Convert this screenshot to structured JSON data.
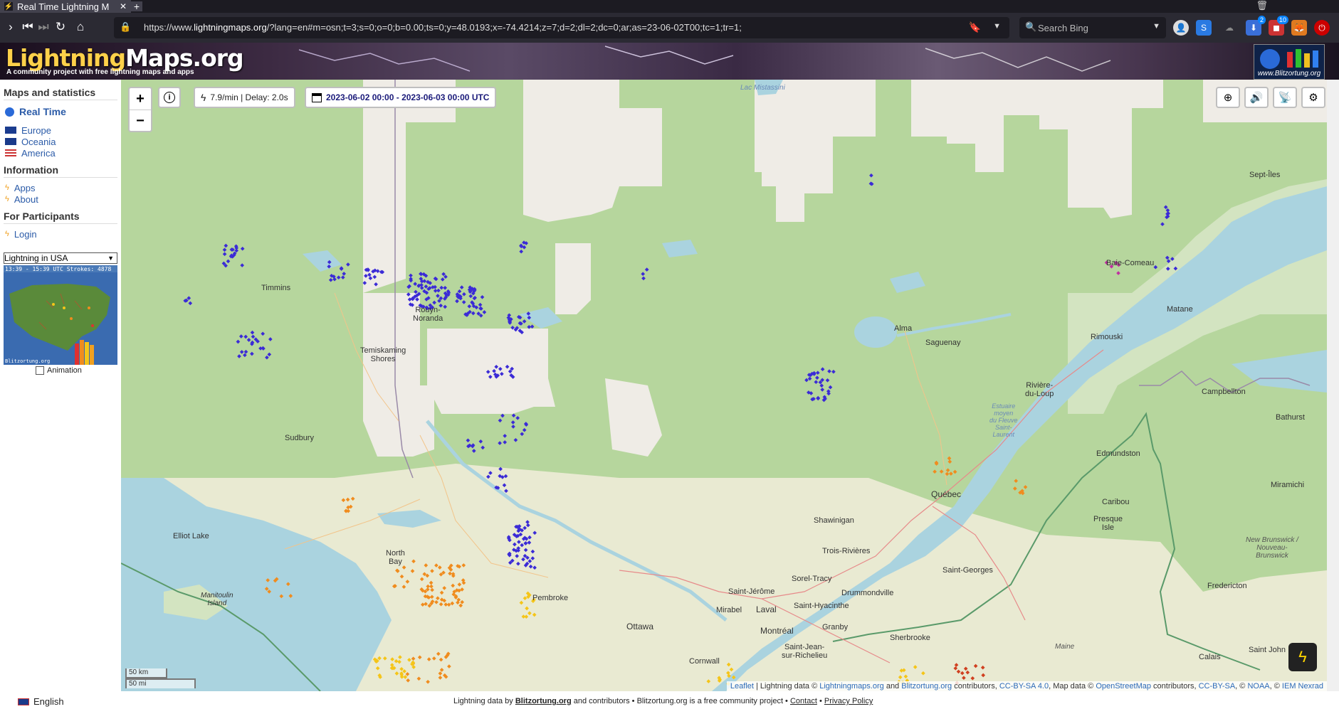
{
  "browser": {
    "tab_title": "Real Time Lightning M",
    "url_prefix": "https://www.",
    "url_domain": "lightningmaps.org",
    "url_rest": "/?lang=en#m=osn;t=3;s=0;o=0;b=0.00;ts=0;y=48.0193;x=-74.4214;z=7;d=2;dl=2;dc=0;ar;as=23-06-02T00;tc=1;tr=1;",
    "search_placeholder": "Search Bing",
    "badges": [
      "2",
      "10"
    ]
  },
  "header": {
    "logo_part1": "Lightning",
    "logo_part2": "Maps.org",
    "tagline": "A community project with free lightning maps and apps",
    "partner_logo_text": "www.Blitzortung.org"
  },
  "sidebar": {
    "section_maps": "Maps and statistics",
    "realtime": "Real Time",
    "regions": [
      "Europe",
      "Oceania",
      "America"
    ],
    "section_info": "Information",
    "info_items": [
      "Apps",
      "About"
    ],
    "section_participants": "For Participants",
    "login": "Login",
    "select_value": "Lightning in USA",
    "thumb_caption": "13:39 - 15:39 UTC Strokes: 4878",
    "thumb_footer": "Blitzortung.org",
    "animation_label": "Animation"
  },
  "map": {
    "rate_text": "7.9/min | Delay: 2.0s",
    "date_text": "2023-06-02 00:00 - 2023-06-03 00:00 UTC",
    "scale_km": "50 km",
    "scale_mi": "50 mi",
    "labels": {
      "lac_mistassini": "Lac Mistassini",
      "timmins": "Timmins",
      "rouyn": "Rouyn-\nNoranda",
      "temiskaming": "Temiskaming\nShores",
      "sudbury": "Sudbury",
      "elliot": "Elliot Lake",
      "north_bay": "North\nBay",
      "manitoulin": "Manitoulin\nIsland",
      "pembroke": "Pembroke",
      "ottawa": "Ottawa",
      "cornwall": "Cornwall",
      "alma": "Alma",
      "saguenay": "Saguenay",
      "baie_comeau": "Baie-Comeau",
      "sept_iles": "Sept-Îles",
      "matane": "Matane",
      "rimouski": "Rimouski",
      "riviere_du_loup": "Rivière-\ndu-Loup",
      "estuaire": "Estuaire\nmoyen\ndu Fleuve\nSaint-\nLaurent",
      "campbellton": "Campbellton",
      "bathurst": "Bathurst",
      "edmundston": "Edmundston",
      "caribou": "Caribou",
      "presque_isle": "Presque\nIsle",
      "miramichi": "Miramichi",
      "new_brunswick": "New Brunswick /\nNouveau-\nBrunswick",
      "fredericton": "Fredericton",
      "quebec": "Québec",
      "shawinigan": "Shawinigan",
      "trois_rivieres": "Trois-Rivières",
      "sorel": "Sorel-Tracy",
      "drummondville": "Drummondville",
      "saint_georges": "Saint-Georges",
      "saint_jerome": "Saint-Jérôme",
      "mirabel": "Mirabel",
      "laval": "Laval",
      "saint_hyacinthe": "Saint-Hyacinthe",
      "montreal": "Montréal",
      "granby": "Granby",
      "sherbrooke": "Sherbrooke",
      "saint_jean": "Saint-Jean-\nsur-Richelieu",
      "maine": "Maine",
      "saint_john": "Saint John",
      "calais": "Calais"
    },
    "attribution": {
      "leaflet": "Leaflet",
      "text1": " | Lightning data © ",
      "lm": "Lightningmaps.org",
      "and": " and ",
      "bo": "Blitzortung.org",
      "contrib": " contributors, ",
      "ccby": "CC-BY-SA 4.0",
      "mapdata": ", Map data © ",
      "osm": "OpenStreetMap",
      "contrib2": " contributors, ",
      "ccby2": "CC-BY-SA",
      "sep": ", © ",
      "noaa": "NOAA",
      "sep2": ", © ",
      "iem": "IEM Nexrad"
    }
  },
  "footer": {
    "language": "English",
    "credits_pre": "Lightning data by ",
    "blitz": "Blitzortung.org",
    "credits_mid": " and contributors • Blitzortung.org is a free community project • ",
    "contact": "Contact",
    "sep": " • ",
    "privacy": "Privacy Policy"
  },
  "colors": {
    "recent_strike": "#3b2bd6",
    "older_strike_orange": "#f08c1e",
    "old_strike_yellow": "#f5c518",
    "map_land": "#b6d69d",
    "map_water": "#aad3df"
  }
}
